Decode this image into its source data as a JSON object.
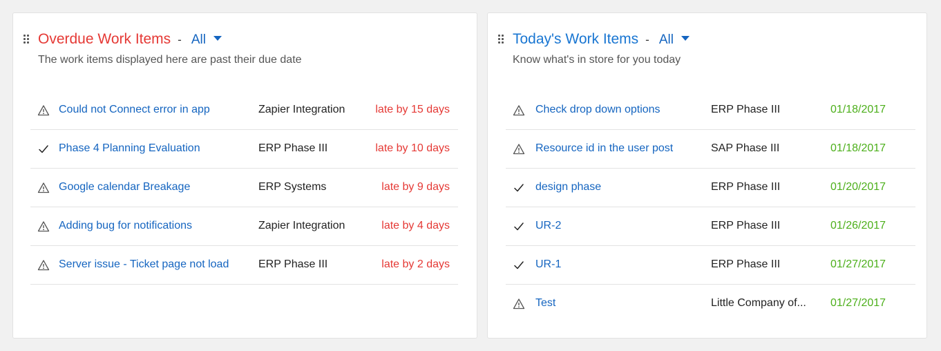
{
  "colors": {
    "overdue_title": "#e53935",
    "today_title": "#1976d2",
    "link": "#1565c0",
    "late": "#e53935",
    "date": "#4caf1a"
  },
  "overdue": {
    "title": "Overdue Work Items",
    "separator": "-",
    "filter_label": "All",
    "subtitle": "The work items displayed here are past their due date",
    "items": [
      {
        "icon": "warning-icon",
        "title": "Could not Connect error in app",
        "project": "Zapier Integration",
        "due": "late by 15 days"
      },
      {
        "icon": "checkmark-icon",
        "title": "Phase 4 Planning Evaluation",
        "project": "ERP Phase III",
        "due": "late by 10 days"
      },
      {
        "icon": "warning-icon",
        "title": "Google calendar Breakage",
        "project": "ERP Systems",
        "due": "late by 9 days"
      },
      {
        "icon": "warning-icon",
        "title": "Adding bug for notifications",
        "project": "Zapier Integration",
        "due": "late by 4 days"
      },
      {
        "icon": "warning-icon",
        "title": "Server issue - Ticket page not load",
        "project": "ERP Phase III",
        "due": "late by 2 days"
      }
    ]
  },
  "today": {
    "title": "Today's Work Items",
    "separator": "-",
    "filter_label": "All",
    "subtitle": "Know what's in store for you today",
    "items": [
      {
        "icon": "warning-icon",
        "title": "Check drop down options",
        "project": "ERP Phase III",
        "due": "01/18/2017"
      },
      {
        "icon": "warning-icon",
        "title": "Resource id in the user post",
        "project": "SAP Phase III",
        "due": "01/18/2017"
      },
      {
        "icon": "checkmark-icon",
        "title": "design phase",
        "project": "ERP Phase III",
        "due": "01/20/2017"
      },
      {
        "icon": "checkmark-icon",
        "title": "UR-2",
        "project": "ERP Phase III",
        "due": "01/26/2017"
      },
      {
        "icon": "checkmark-icon",
        "title": "UR-1",
        "project": "ERP Phase III",
        "due": "01/27/2017"
      },
      {
        "icon": "warning-icon",
        "title": "Test",
        "project": "Little Company of...",
        "due": "01/27/2017"
      }
    ]
  }
}
